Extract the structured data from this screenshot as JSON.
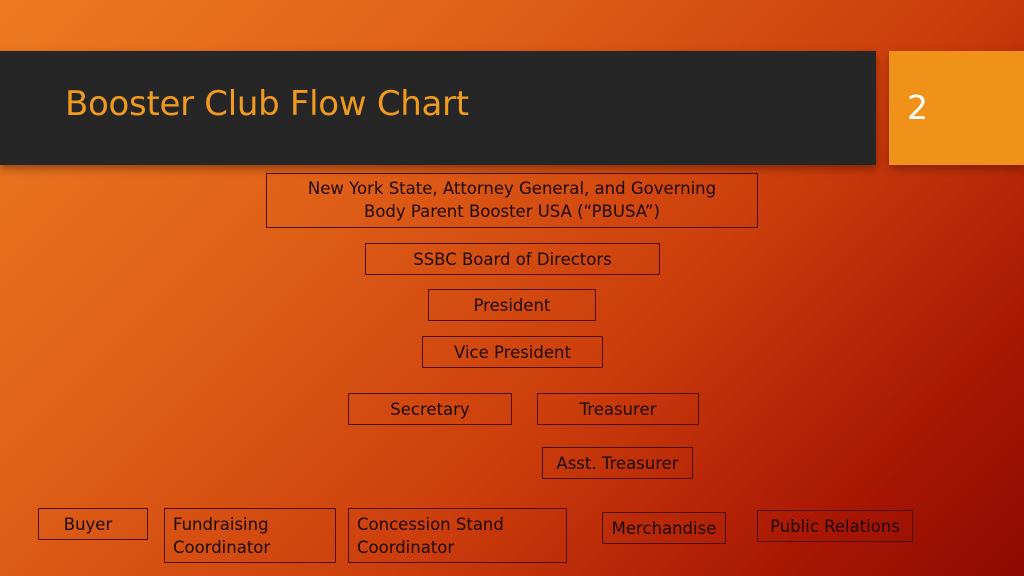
{
  "slide": {
    "title": "Booster Club Flow Chart",
    "page_number": "2"
  },
  "colors": {
    "title_bar": "#262626",
    "title_text": "#f09a1e",
    "page_badge": "#f0921a",
    "background_start": "#ec7a22",
    "background_end": "#8e0a02"
  },
  "nodes": {
    "governing_line1": "New York State, Attorney General, and Governing",
    "governing_line2": "Body Parent Booster USA (“PBUSA”)",
    "board": "SSBC Board of Directors",
    "president": "President",
    "vice_president": "Vice President",
    "secretary": "Secretary",
    "treasurer": "Treasurer",
    "asst_treasurer": "Asst. Treasurer",
    "buyer": "Buyer",
    "fundraising_line1": "Fundraising",
    "fundraising_line2": "Coordinator",
    "concession_line1": "Concession Stand",
    "concession_line2": "Coordinator",
    "merchandise": "Merchandise",
    "public_relations": "Public Relations"
  }
}
